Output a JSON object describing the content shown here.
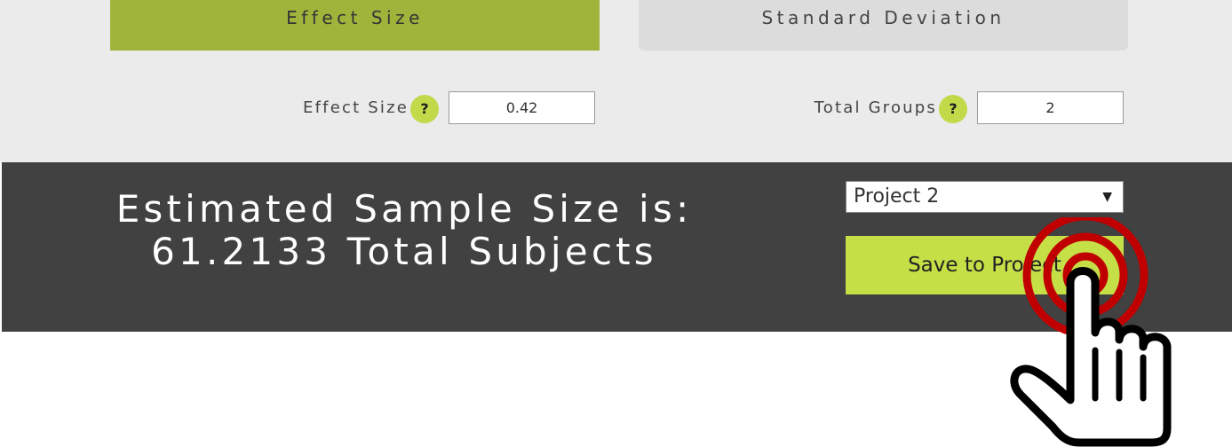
{
  "tabs": {
    "effect_size": "Effect Size",
    "standard_deviation": "Standard Deviation"
  },
  "fields": {
    "effect_size_label": "Effect Size",
    "effect_size_help": "?",
    "effect_size_value": "0.42",
    "total_groups_label": "Total Groups",
    "total_groups_help": "?",
    "total_groups_value": "2"
  },
  "result": {
    "line1": "Estimated Sample Size is:",
    "line2": "61.2133 Total Subjects"
  },
  "project_select": {
    "selected": "Project 2",
    "arrow": "▼"
  },
  "save_button": {
    "label": "Save to Project"
  },
  "icons": {
    "overlay": "hand-pointer-click-icon"
  },
  "colors": {
    "active_tab": "#a0b43c",
    "inactive_tab": "#dcdcdc",
    "accent_green": "#c5df47",
    "dark_panel": "#414141",
    "click_ring": "#c00000"
  }
}
